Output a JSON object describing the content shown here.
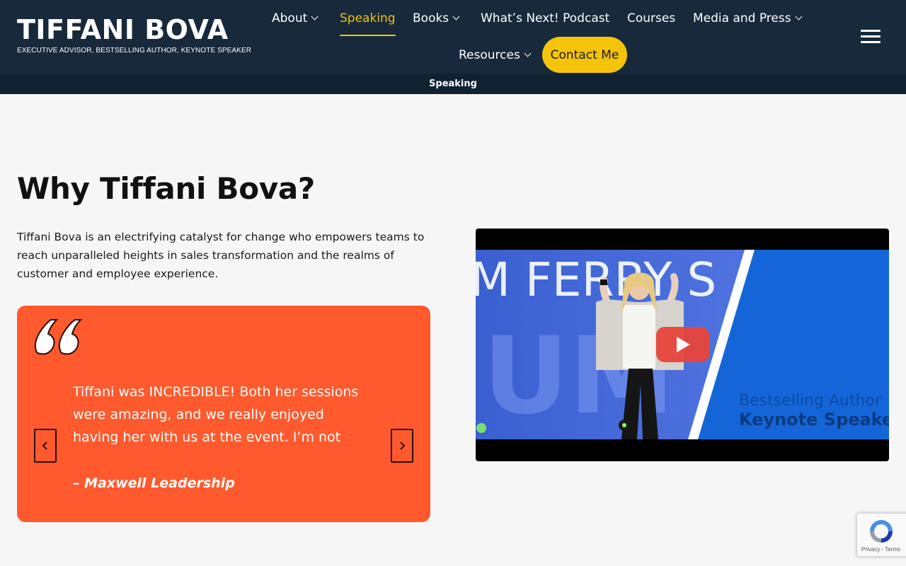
{
  "header": {
    "logo_name": "TIFFANI BOVA",
    "logo_tagline": "EXECUTIVE ADVISOR, BESTSELLING AUTHOR, KEYNOTE SPEAKER",
    "nav": {
      "about": "About",
      "speaking": "Speaking",
      "books": "Books",
      "podcast": "What’s Next! Podcast",
      "courses": "Courses",
      "media": "Media and Press",
      "resources": "Resources",
      "contact": "Contact Me"
    },
    "active_item": "Speaking",
    "accent_color": "#f5c40a",
    "background_color": "#17293b"
  },
  "breadcrumb": {
    "current": "Speaking"
  },
  "main": {
    "heading": "Why Tiffani Bova?",
    "intro": "Tiffani Bova is an electrifying catalyst for change who empowers teams to reach unparalleled heights in sales transformation and the realms of customer and employee experience."
  },
  "testimonial": {
    "quote": "Tiffani was INCREDIBLE! Both her sessions were amazing, and we really enjoyed having her with us at the event. I’m not sure that",
    "author": "– Maxwell Leadership",
    "background_color": "#ff5a2e",
    "prev_icon": "chevron-left-icon",
    "next_icon": "chevron-right-icon"
  },
  "video": {
    "backdrop_text": "M FERRY S",
    "overlay_line1": "Bestselling Author",
    "overlay_line2": "Keynote Speaker",
    "play_icon": "play-icon"
  },
  "recaptcha": {
    "terms": "Privacy - Terms"
  }
}
